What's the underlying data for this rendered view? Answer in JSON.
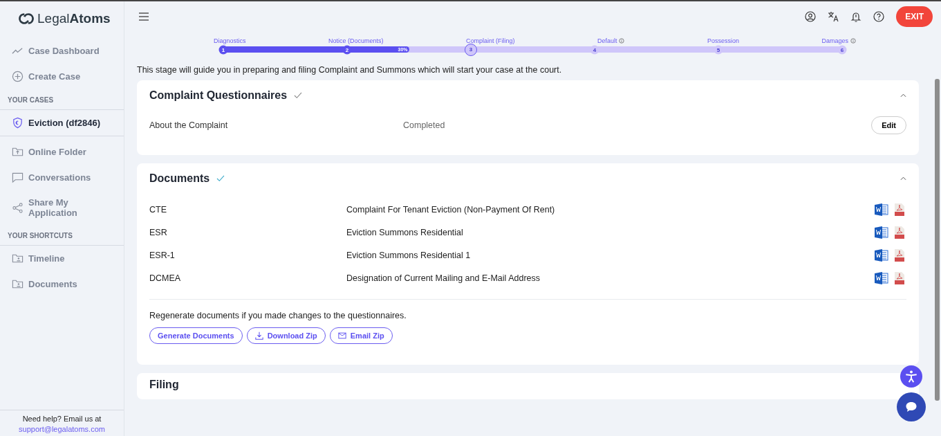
{
  "brand": {
    "light": "Legal",
    "bold": "Atoms"
  },
  "sidebar": {
    "top_items": [
      {
        "label": "Case Dashboard",
        "kind": "chart"
      },
      {
        "label": "Create Case",
        "kind": "plus"
      }
    ],
    "cases_heading": "YOUR CASES",
    "cases": [
      {
        "label": "Eviction (df2846)",
        "selected": true
      }
    ],
    "case_items": [
      {
        "label": "Online Folder",
        "kind": "folder-up"
      },
      {
        "label": "Conversations",
        "kind": "chat"
      },
      {
        "label": "Share My Application",
        "kind": "share"
      }
    ],
    "shortcuts_heading": "YOUR SHORTCUTS",
    "shortcuts": [
      {
        "label": "Timeline",
        "kind": "folder-user"
      },
      {
        "label": "Documents",
        "kind": "folder-user"
      }
    ],
    "help": {
      "text": "Need help? Email us at",
      "email": "support@legalatoms.com"
    }
  },
  "header": {
    "exit": "EXIT"
  },
  "stepper": {
    "level": 0.3,
    "percent": "30%",
    "steps": [
      {
        "label": "Diagnostics",
        "number": "1",
        "completed": true,
        "selected": false,
        "info": false
      },
      {
        "label": "Notice (Documents)",
        "number": "2",
        "completed": true,
        "selected": false,
        "info": false
      },
      {
        "label": "Complaint (Filing)",
        "number": "3",
        "completed": false,
        "selected": true,
        "info": false
      },
      {
        "label": "Default",
        "number": "4",
        "completed": false,
        "selected": false,
        "info": true
      },
      {
        "label": "Possession",
        "number": "5",
        "completed": false,
        "selected": false,
        "info": false
      },
      {
        "label": "Damages",
        "number": "6",
        "completed": false,
        "selected": false,
        "info": true
      }
    ]
  },
  "intro": "This stage will guide you in preparing and filing Complaint and Summons which will start your case at the court.",
  "questionnaires": {
    "title": "Complaint Questionnaires",
    "done": true,
    "expanded": true,
    "rows": [
      {
        "name": "About the Complaint",
        "status": "Completed",
        "action": "Edit"
      }
    ]
  },
  "documents": {
    "title": "Documents",
    "done": true,
    "expanded": true,
    "rows": [
      {
        "code": "CTE",
        "name": "Complaint For Tenant Eviction (Non-Payment Of Rent)"
      },
      {
        "code": "ESR",
        "name": "Eviction Summons Residential"
      },
      {
        "code": "ESR-1",
        "name": "Eviction Summons Residential 1"
      },
      {
        "code": "DCMEA",
        "name": "Designation of Current Mailing and E-Mail Address"
      }
    ],
    "note": "Regenerate documents if you made changes to the questionnaires.",
    "buttons": [
      {
        "label": "Generate Documents",
        "kind": "plain"
      },
      {
        "label": "Download Zip",
        "kind": "download"
      },
      {
        "label": "Email Zip",
        "kind": "mail"
      }
    ]
  },
  "filing": {
    "title": "Filing"
  }
}
